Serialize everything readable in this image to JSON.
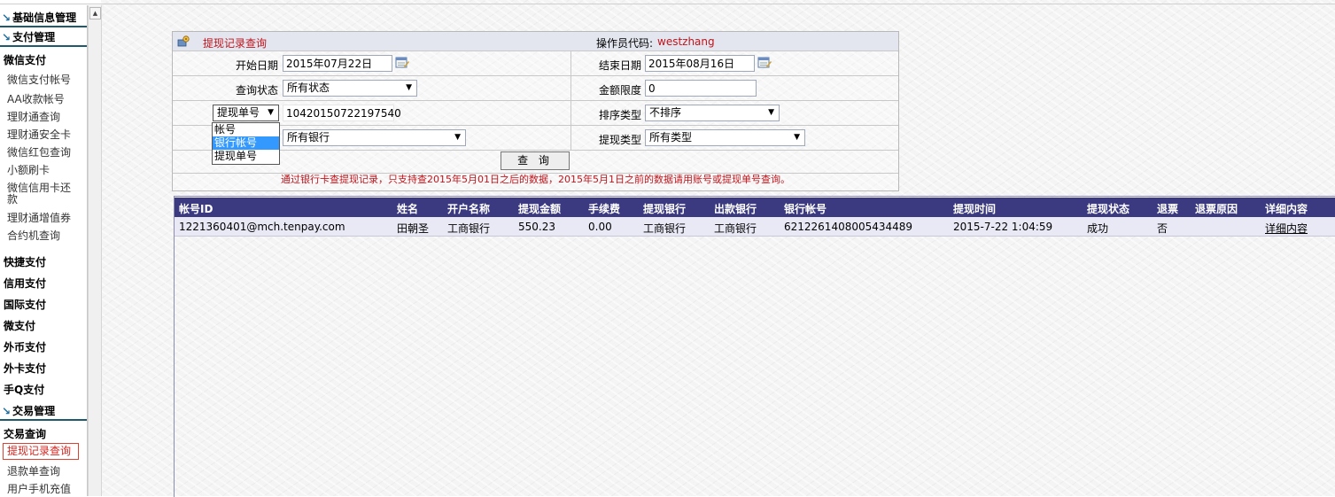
{
  "sidebar": {
    "sections": [
      {
        "title": "基础信息管理"
      },
      {
        "title": "支付管理"
      },
      {
        "title": "交易管理"
      }
    ],
    "pay": {
      "wechat_group": "微信支付",
      "wechat_items": [
        "微信支付帐号",
        "AA收款帐号",
        "理财通查询",
        "理财通安全卡",
        "微信红包查询",
        "小额刷卡",
        "微信信用卡还款",
        "理财通增值券",
        "合约机查询"
      ],
      "groups": [
        "快捷支付",
        "信用支付",
        "国际支付",
        "微支付",
        "外币支付",
        "外卡支付",
        "手Q支付"
      ]
    },
    "trade": {
      "group": "交易查询",
      "items": [
        "提现记录查询",
        "退款单查询",
        "用户手机充值"
      ]
    }
  },
  "panel": {
    "title": "提现记录查询",
    "operator_label": "操作员代码:",
    "operator_value": "westzhang",
    "start_date_label": "开始日期",
    "start_date_value": "2015年07月22日",
    "end_date_label": "结束日期",
    "end_date_value": "2015年08月16日",
    "status_label": "查询状态",
    "status_value": "所有状态",
    "amount_label": "金额限度",
    "amount_value": "0",
    "id_type_value": "提现单号",
    "id_value": "10420150722197540",
    "sort_label": "排序类型",
    "sort_value": "不排序",
    "bank_value": "所有银行",
    "withdraw_type_label": "提现类型",
    "withdraw_type_value": "所有类型",
    "id_type_options": [
      "帐号",
      "银行帐号",
      "提现单号"
    ],
    "query_button": "查 询",
    "notice": "通过银行卡查提现记录，只支持查2015年5月01日之后的数据，2015年5月1日之前的数据请用账号或提现单号查询。"
  },
  "results": {
    "columns": [
      "帐号ID",
      "姓名",
      "开户名称",
      "提现金额",
      "手续费",
      "提现银行",
      "出款银行",
      "银行帐号",
      "提现时间",
      "提现状态",
      "退票",
      "退票原因",
      "详细内容"
    ],
    "rows": [
      [
        "1221360401@mch.tenpay.com",
        "田朝圣",
        "工商银行",
        "550.23",
        "0.00",
        "工商银行",
        "工商银行",
        "6212261408005434489",
        "2015-7-22 1:04:59",
        "成功",
        "否",
        "",
        "详细内容"
      ]
    ]
  },
  "colors": {
    "header_bg": "#3b3a80",
    "accent_red": "#c0141b",
    "row_bg": "#e9e9f6"
  }
}
